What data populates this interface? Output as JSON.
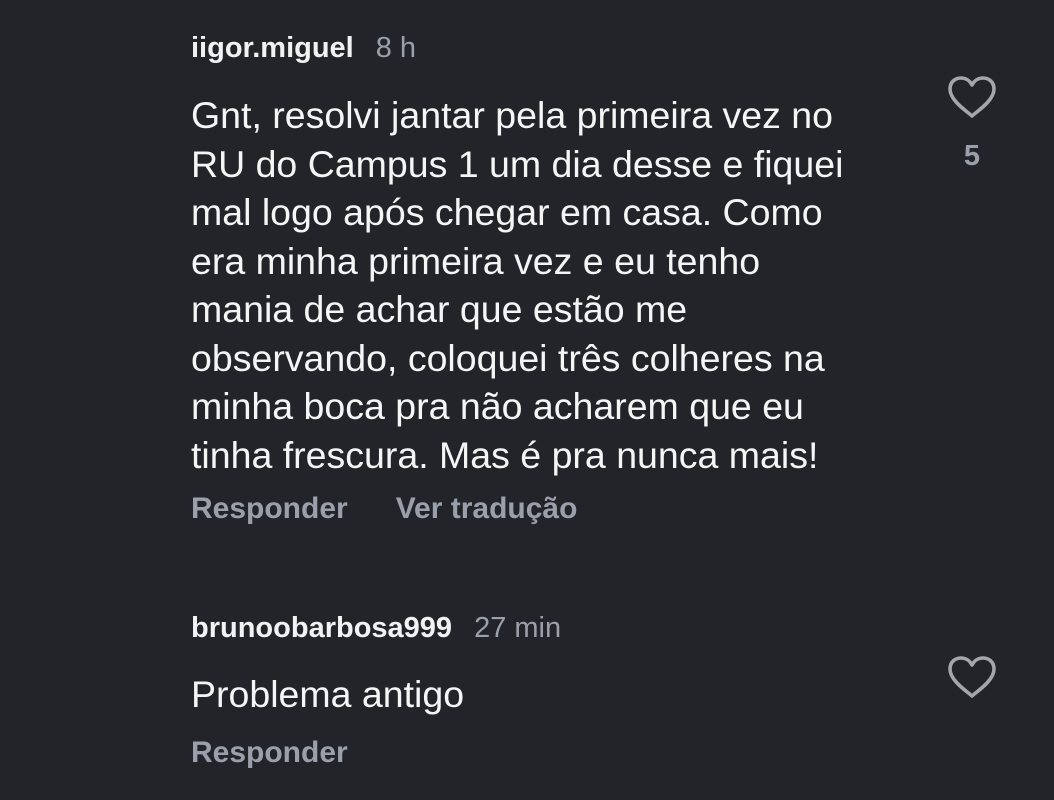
{
  "comments": [
    {
      "username": "iigor.miguel",
      "time": "8 h",
      "text": "Gnt, resolvi jantar pela primeira vez no\nRU do Campus 1 um dia desse e fiquei\nmal logo após chegar em casa. Como\nera minha primeira vez e eu tenho\nmania de achar que estão me\nobservando, coloquei três colheres na\nminha boca pra não acharem que eu\ntinha frescura. Mas é pra nunca mais!",
      "reply_label": "Responder",
      "translate_label": "Ver tradução",
      "like_icon": "heart-outline-icon",
      "like_count": "5"
    },
    {
      "username": "brunoobarbosa999",
      "time": "27 min",
      "text": "Problema antigo",
      "reply_label": "Responder",
      "like_icon": "heart-outline-icon"
    }
  ],
  "colors": {
    "background": "#232429",
    "text_primary": "#f5f5f5",
    "text_secondary": "#9aa0ab"
  }
}
